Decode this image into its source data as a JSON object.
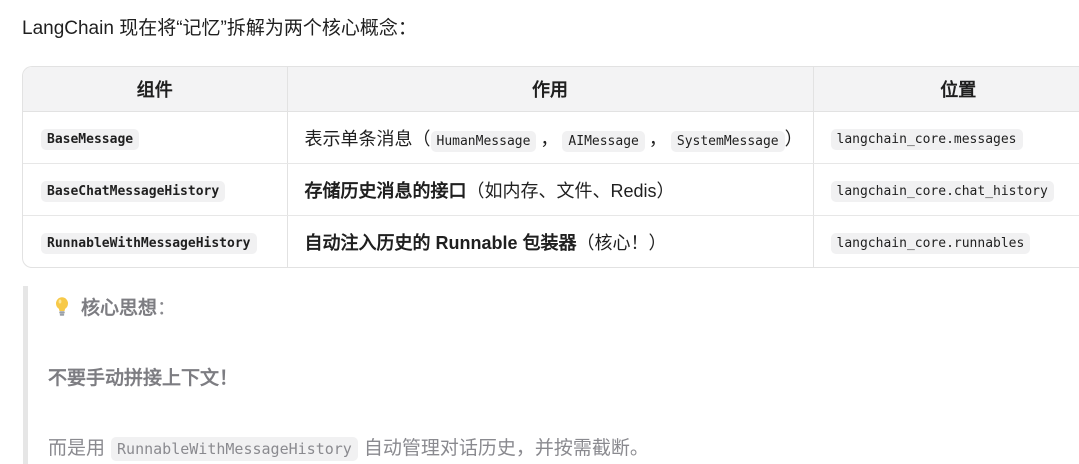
{
  "intro": "LangChain 现在将“记忆”拆解为两个核心概念：",
  "table": {
    "headers": [
      "组件",
      "作用",
      "位置"
    ],
    "rows": [
      {
        "component": "BaseMessage",
        "role_prefix": "表示单条消息（",
        "role_codes": [
          "HumanMessage",
          "AIMessage",
          "SystemMessage"
        ],
        "role_sep": "，",
        "role_suffix": "）",
        "location": "langchain_core.messages"
      },
      {
        "component": "BaseChatMessageHistory",
        "role_strong": "存储历史消息的接口",
        "role_rest": "（如内存、文件、Redis）",
        "location": "langchain_core.chat_history"
      },
      {
        "component": "RunnableWithMessageHistory",
        "role_strong": "自动注入历史的 Runnable 包装器",
        "role_rest": "（核心！）",
        "location": "langchain_core.runnables"
      }
    ]
  },
  "quote": {
    "icon": "lightbulb-icon",
    "title": "核心思想",
    "title_colon": "：",
    "line2": "不要手动拼接上下文！",
    "line3_prefix": "而是用",
    "line3_code": "RunnableWithMessageHistory",
    "line3_suffix": "自动管理对话历史，并按需截断。"
  }
}
